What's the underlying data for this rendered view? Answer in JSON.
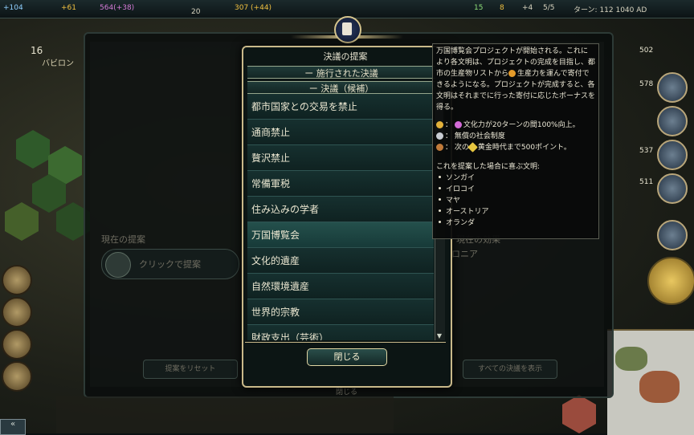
{
  "topbar": {
    "science": "+104",
    "gold_partial": "+61",
    "culture": "564(+38)",
    "faith": "20",
    "gold_total": "307 (+44)",
    "happiness": "15",
    "golden": "8",
    "tourism": "+4",
    "policies": "5/5",
    "turn": "ターン: 112  1040 AD"
  },
  "city_banner": {
    "pop": "16",
    "name": "バビロン"
  },
  "background_panel": {
    "current_proposal_label": "現在の提案",
    "click_to_propose": "クリックで提案",
    "reset_button": "提案をリセット",
    "show_all_button": "すべての決議を表示",
    "close_label": "閉じる",
    "right_label1": "現在の効果",
    "right_label2": "ロニア"
  },
  "popup": {
    "title": "決議の提案",
    "section_enacted": "ー  施行された決議",
    "section_candidates": "ー  決議（候補）",
    "items": [
      "都市国家との交易を禁止",
      "通商禁止",
      "贅沢禁止",
      "常備軍税",
      "住み込みの学者",
      "万国博覧会",
      "文化的遺産",
      "自然環境遺産",
      "世界的宗教",
      "財政支出（芸術）"
    ],
    "close_button": "閉じる"
  },
  "tooltip": {
    "description": "万国博覧会プロジェクトが開始される。これにより各文明は、プロジェクトの完成を目指し、都市の生産物リストから",
    "description2": "生産力を運んで寄付できるようになる。プロジェクトが完成すると、各文明はそれまでに行った寄付に応じたボーナスを得る。",
    "reward_gold_label": "文化力が20ターンの間100%向上。",
    "reward_silver": "無償の社会制度",
    "reward_bronze_label": "黄金時代まで500ポイント。",
    "reward_bronze_prefix": "次の",
    "pleased_header": "これを提案した場合に喜ぶ文明:",
    "civs": [
      "ソンガイ",
      "イロコイ",
      "マヤ",
      "オーストリア",
      "オランダ"
    ]
  },
  "right_stats": [
    "502",
    "578",
    "537",
    "511"
  ],
  "colors": {
    "accent_gold": "#c9b98a",
    "row_bg": "#16302f",
    "text": "#eae6d0"
  }
}
